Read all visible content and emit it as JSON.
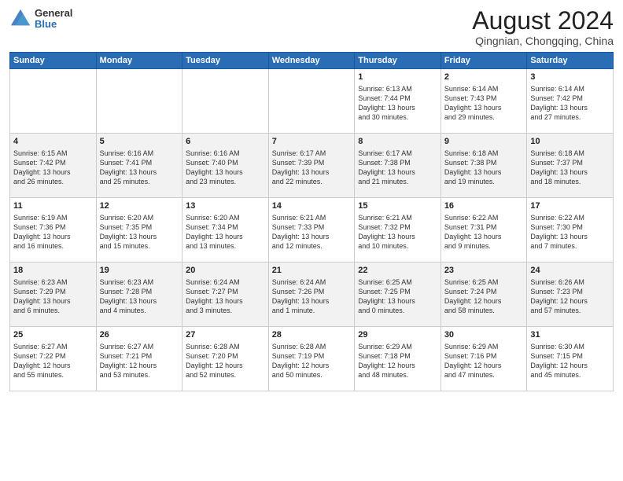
{
  "logo": {
    "general": "General",
    "blue": "Blue"
  },
  "title": {
    "month_year": "August 2024",
    "location": "Qingnian, Chongqing, China"
  },
  "weekdays": [
    "Sunday",
    "Monday",
    "Tuesday",
    "Wednesday",
    "Thursday",
    "Friday",
    "Saturday"
  ],
  "weeks": [
    [
      {
        "day": "",
        "info": ""
      },
      {
        "day": "",
        "info": ""
      },
      {
        "day": "",
        "info": ""
      },
      {
        "day": "",
        "info": ""
      },
      {
        "day": "1",
        "info": "Sunrise: 6:13 AM\nSunset: 7:44 PM\nDaylight: 13 hours\nand 30 minutes."
      },
      {
        "day": "2",
        "info": "Sunrise: 6:14 AM\nSunset: 7:43 PM\nDaylight: 13 hours\nand 29 minutes."
      },
      {
        "day": "3",
        "info": "Sunrise: 6:14 AM\nSunset: 7:42 PM\nDaylight: 13 hours\nand 27 minutes."
      }
    ],
    [
      {
        "day": "4",
        "info": "Sunrise: 6:15 AM\nSunset: 7:42 PM\nDaylight: 13 hours\nand 26 minutes."
      },
      {
        "day": "5",
        "info": "Sunrise: 6:16 AM\nSunset: 7:41 PM\nDaylight: 13 hours\nand 25 minutes."
      },
      {
        "day": "6",
        "info": "Sunrise: 6:16 AM\nSunset: 7:40 PM\nDaylight: 13 hours\nand 23 minutes."
      },
      {
        "day": "7",
        "info": "Sunrise: 6:17 AM\nSunset: 7:39 PM\nDaylight: 13 hours\nand 22 minutes."
      },
      {
        "day": "8",
        "info": "Sunrise: 6:17 AM\nSunset: 7:38 PM\nDaylight: 13 hours\nand 21 minutes."
      },
      {
        "day": "9",
        "info": "Sunrise: 6:18 AM\nSunset: 7:38 PM\nDaylight: 13 hours\nand 19 minutes."
      },
      {
        "day": "10",
        "info": "Sunrise: 6:18 AM\nSunset: 7:37 PM\nDaylight: 13 hours\nand 18 minutes."
      }
    ],
    [
      {
        "day": "11",
        "info": "Sunrise: 6:19 AM\nSunset: 7:36 PM\nDaylight: 13 hours\nand 16 minutes."
      },
      {
        "day": "12",
        "info": "Sunrise: 6:20 AM\nSunset: 7:35 PM\nDaylight: 13 hours\nand 15 minutes."
      },
      {
        "day": "13",
        "info": "Sunrise: 6:20 AM\nSunset: 7:34 PM\nDaylight: 13 hours\nand 13 minutes."
      },
      {
        "day": "14",
        "info": "Sunrise: 6:21 AM\nSunset: 7:33 PM\nDaylight: 13 hours\nand 12 minutes."
      },
      {
        "day": "15",
        "info": "Sunrise: 6:21 AM\nSunset: 7:32 PM\nDaylight: 13 hours\nand 10 minutes."
      },
      {
        "day": "16",
        "info": "Sunrise: 6:22 AM\nSunset: 7:31 PM\nDaylight: 13 hours\nand 9 minutes."
      },
      {
        "day": "17",
        "info": "Sunrise: 6:22 AM\nSunset: 7:30 PM\nDaylight: 13 hours\nand 7 minutes."
      }
    ],
    [
      {
        "day": "18",
        "info": "Sunrise: 6:23 AM\nSunset: 7:29 PM\nDaylight: 13 hours\nand 6 minutes."
      },
      {
        "day": "19",
        "info": "Sunrise: 6:23 AM\nSunset: 7:28 PM\nDaylight: 13 hours\nand 4 minutes."
      },
      {
        "day": "20",
        "info": "Sunrise: 6:24 AM\nSunset: 7:27 PM\nDaylight: 13 hours\nand 3 minutes."
      },
      {
        "day": "21",
        "info": "Sunrise: 6:24 AM\nSunset: 7:26 PM\nDaylight: 13 hours\nand 1 minute."
      },
      {
        "day": "22",
        "info": "Sunrise: 6:25 AM\nSunset: 7:25 PM\nDaylight: 13 hours\nand 0 minutes."
      },
      {
        "day": "23",
        "info": "Sunrise: 6:25 AM\nSunset: 7:24 PM\nDaylight: 12 hours\nand 58 minutes."
      },
      {
        "day": "24",
        "info": "Sunrise: 6:26 AM\nSunset: 7:23 PM\nDaylight: 12 hours\nand 57 minutes."
      }
    ],
    [
      {
        "day": "25",
        "info": "Sunrise: 6:27 AM\nSunset: 7:22 PM\nDaylight: 12 hours\nand 55 minutes."
      },
      {
        "day": "26",
        "info": "Sunrise: 6:27 AM\nSunset: 7:21 PM\nDaylight: 12 hours\nand 53 minutes."
      },
      {
        "day": "27",
        "info": "Sunrise: 6:28 AM\nSunset: 7:20 PM\nDaylight: 12 hours\nand 52 minutes."
      },
      {
        "day": "28",
        "info": "Sunrise: 6:28 AM\nSunset: 7:19 PM\nDaylight: 12 hours\nand 50 minutes."
      },
      {
        "day": "29",
        "info": "Sunrise: 6:29 AM\nSunset: 7:18 PM\nDaylight: 12 hours\nand 48 minutes."
      },
      {
        "day": "30",
        "info": "Sunrise: 6:29 AM\nSunset: 7:16 PM\nDaylight: 12 hours\nand 47 minutes."
      },
      {
        "day": "31",
        "info": "Sunrise: 6:30 AM\nSunset: 7:15 PM\nDaylight: 12 hours\nand 45 minutes."
      }
    ]
  ]
}
